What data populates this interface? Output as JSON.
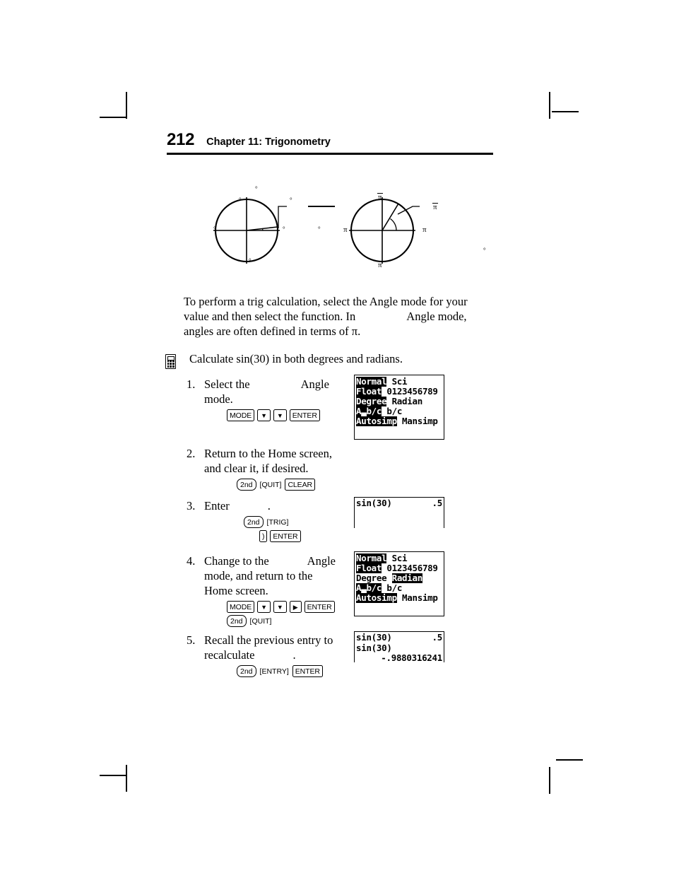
{
  "header": {
    "page_number": "212",
    "chapter_title": "Chapter 11: Trigonometry"
  },
  "figures": {
    "degree_circle": {
      "name": "degree-angle-circle",
      "labels": [
        "°",
        "°",
        "°",
        "°",
        "°",
        "°",
        "°"
      ]
    },
    "radian_circle": {
      "name": "radian-angle-circle",
      "labels": [
        "π",
        "π",
        "π",
        "π",
        "π",
        "°"
      ]
    }
  },
  "intro": {
    "line1": "To perform a trig calculation, select the Angle mode for your",
    "line2a": "value and then select the function. In",
    "line2b": "Angle mode,",
    "line3": "angles are often defined in terms of π."
  },
  "example": {
    "text": "Calculate sin(30) in both degrees and radians.",
    "icon": "calculator-icon"
  },
  "steps": [
    {
      "number": "1.",
      "text_a": "Select the",
      "text_b": "Angle",
      "text_c": "mode.",
      "keys": [
        [
          {
            "type": "box",
            "label": "MODE"
          },
          {
            "type": "arrow",
            "label": "▼"
          },
          {
            "type": "arrow",
            "label": "▼"
          },
          {
            "type": "box",
            "label": "ENTER"
          }
        ]
      ]
    },
    {
      "number": "2.",
      "text_a": "Return to the Home screen,",
      "text_c": "and clear it, if desired.",
      "keys": [
        [
          {
            "type": "round",
            "label": "2nd"
          },
          {
            "type": "bracket",
            "label": "[QUIT]"
          },
          {
            "type": "box",
            "label": "CLEAR"
          }
        ]
      ]
    },
    {
      "number": "3.",
      "text_a": "Enter",
      "text_c": ".",
      "keys": [
        [
          {
            "type": "round",
            "label": "2nd"
          },
          {
            "type": "bracket",
            "label": "[TRIG]"
          }
        ],
        [
          {
            "type": "box",
            "label": ")"
          },
          {
            "type": "box",
            "label": "ENTER"
          }
        ]
      ]
    },
    {
      "number": "4.",
      "text_a": "Change to the",
      "text_b": "Angle",
      "text_c": "mode, and return to the",
      "text_d": "Home screen.",
      "keys": [
        [
          {
            "type": "box",
            "label": "MODE"
          },
          {
            "type": "arrow",
            "label": "▼"
          },
          {
            "type": "arrow",
            "label": "▼"
          },
          {
            "type": "arrow",
            "label": "▶"
          },
          {
            "type": "box",
            "label": "ENTER"
          }
        ],
        [
          {
            "type": "round",
            "label": "2nd"
          },
          {
            "type": "bracket",
            "label": "[QUIT]"
          }
        ]
      ]
    },
    {
      "number": "5.",
      "text_a": "Recall the previous entry to",
      "text_c": "recalculate",
      "text_d": ".",
      "keys": [
        [
          {
            "type": "round",
            "label": "2nd"
          },
          {
            "type": "bracket",
            "label": "[ENTRY]"
          },
          {
            "type": "box",
            "label": "ENTER"
          }
        ]
      ]
    }
  ],
  "screens": {
    "mode_degree": {
      "name": "mode-screen-degree",
      "rows": [
        [
          {
            "t": "Normal",
            "inv": true
          },
          {
            "t": " Sci",
            "inv": false
          }
        ],
        [
          {
            "t": "Float",
            "inv": true
          },
          {
            "t": " 0123456789",
            "inv": false
          }
        ],
        [
          {
            "t": "Degree",
            "inv": true
          },
          {
            "t": " Radian",
            "inv": false
          }
        ],
        [
          {
            "t": "A▃b/c",
            "inv": true
          },
          {
            "t": " b/c",
            "inv": false
          }
        ],
        [
          {
            "t": "Autosimp",
            "inv": true
          },
          {
            "t": " Mansimp",
            "inv": false
          }
        ]
      ]
    },
    "mode_radian": {
      "name": "mode-screen-radian",
      "rows": [
        [
          {
            "t": "Normal",
            "inv": true
          },
          {
            "t": " Sci",
            "inv": false
          }
        ],
        [
          {
            "t": "Float",
            "inv": true
          },
          {
            "t": " 0123456789",
            "inv": false
          }
        ],
        [
          {
            "t": "Degree",
            "inv": false
          },
          {
            "t": " ",
            "inv": false
          },
          {
            "t": "Radian",
            "inv": true
          }
        ],
        [
          {
            "t": "A▃b/c",
            "inv": true
          },
          {
            "t": " b/c",
            "inv": false
          }
        ],
        [
          {
            "t": "Autosimp",
            "inv": true
          },
          {
            "t": " Mansimp",
            "inv": false
          }
        ]
      ]
    },
    "home_degree": {
      "name": "home-screen-sin30-degree",
      "entry": "sin(30)",
      "result": ".5"
    },
    "home_radian": {
      "name": "home-screen-sin30-radian",
      "entry1": "sin(30)",
      "result1": ".5",
      "entry2": "sin(30)",
      "result2": "-.9880316241"
    }
  }
}
